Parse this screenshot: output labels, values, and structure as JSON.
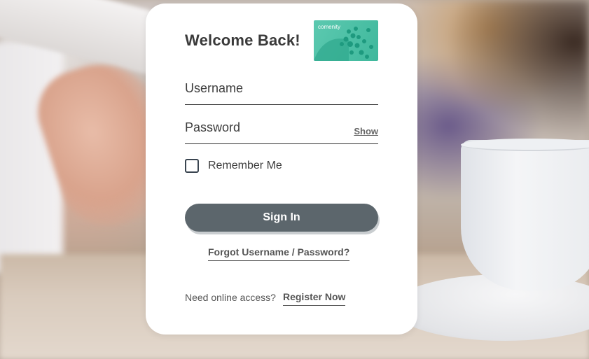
{
  "login": {
    "title": "Welcome Back!",
    "card_brand": "comenity",
    "username_label": "Username",
    "password_label": "Password",
    "show_label": "Show",
    "remember_label": "Remember Me",
    "remember_checked": false,
    "signin_label": "Sign In",
    "forgot_label": "Forgot Username / Password?",
    "need_access_text": "Need online access?",
    "register_label": "Register Now"
  },
  "colors": {
    "card_art": "#4cc0a6",
    "signin_button": "#5c666c",
    "text": "#3d3d3d"
  },
  "icons": [
    "card-art-icon",
    "checkbox-icon"
  ]
}
